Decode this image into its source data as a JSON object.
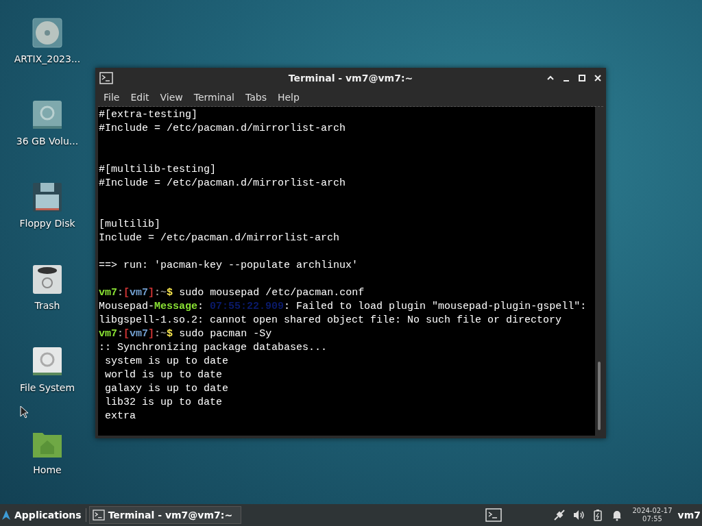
{
  "desktop_icons": [
    {
      "kind": "disc",
      "label": "ARTIX_2023..."
    },
    {
      "kind": "drive",
      "label": "36 GB Volu..."
    },
    {
      "kind": "floppy",
      "label": "Floppy Disk"
    },
    {
      "kind": "trash",
      "label": "Trash"
    },
    {
      "kind": "drive-light",
      "label": "File System"
    },
    {
      "kind": "folder",
      "label": "Home"
    }
  ],
  "window": {
    "title": "Terminal - vm7@vm7:~",
    "menu": [
      "File",
      "Edit",
      "View",
      "Terminal",
      "Tabs",
      "Help"
    ],
    "lines": [
      {
        "kind": "text",
        "text": "#[extra-testing]"
      },
      {
        "kind": "text",
        "text": "#Include = /etc/pacman.d/mirrorlist-arch"
      },
      {
        "kind": "blank"
      },
      {
        "kind": "blank"
      },
      {
        "kind": "text",
        "text": "#[multilib-testing]"
      },
      {
        "kind": "text",
        "text": "#Include = /etc/pacman.d/mirrorlist-arch"
      },
      {
        "kind": "blank"
      },
      {
        "kind": "blank"
      },
      {
        "kind": "text",
        "text": "[multilib]"
      },
      {
        "kind": "text",
        "text": "Include = /etc/pacman.d/mirrorlist-arch"
      },
      {
        "kind": "blank"
      },
      {
        "kind": "text",
        "text": "==> run: 'pacman-key --populate archlinux'"
      },
      {
        "kind": "blank"
      },
      {
        "kind": "segments",
        "segments": [
          {
            "text": "vm7",
            "color": "#8ae234"
          },
          {
            "text": ":",
            "color": "#aaaaaa"
          },
          {
            "text": "[",
            "color": "#cc3333"
          },
          {
            "text": "vm7",
            "color": "#729fcf"
          },
          {
            "text": "]",
            "color": "#cc3333"
          },
          {
            "text": ":",
            "color": "#aaaaaa"
          },
          {
            "text": "~",
            "color": "#888888"
          },
          {
            "text": "$",
            "color": "#fce94f"
          },
          {
            "text": " sudo mousepad /etc/pacman.conf",
            "color": "#ffffff"
          }
        ]
      },
      {
        "kind": "segments",
        "segments": [
          {
            "text": "Mousepad-",
            "color": "#ffffff"
          },
          {
            "text": "Message",
            "color": "#8ae234"
          },
          {
            "text": ": ",
            "color": "#ffffff"
          },
          {
            "text": "07:55:22.909",
            "color": "#0a1a6a"
          },
          {
            "text": ": Failed to load plugin \"mousepad-plugin-gspell\":",
            "color": "#ffffff"
          }
        ]
      },
      {
        "kind": "text",
        "text": "libgspell-1.so.2: cannot open shared object file: No such file or directory"
      },
      {
        "kind": "segments",
        "segments": [
          {
            "text": "vm7",
            "color": "#8ae234"
          },
          {
            "text": ":",
            "color": "#aaaaaa"
          },
          {
            "text": "[",
            "color": "#cc3333"
          },
          {
            "text": "vm7",
            "color": "#729fcf"
          },
          {
            "text": "]",
            "color": "#cc3333"
          },
          {
            "text": ":",
            "color": "#aaaaaa"
          },
          {
            "text": "~",
            "color": "#888888"
          },
          {
            "text": "$",
            "color": "#fce94f"
          },
          {
            "text": " sudo pacman -Sy",
            "color": "#ffffff"
          }
        ]
      },
      {
        "kind": "text",
        "text": ":: Synchronizing package databases..."
      },
      {
        "kind": "text",
        "text": " system is up to date"
      },
      {
        "kind": "text",
        "text": " world is up to date"
      },
      {
        "kind": "text",
        "text": " galaxy is up to date"
      },
      {
        "kind": "text",
        "text": " lib32 is up to date"
      },
      {
        "kind": "text",
        "text": " extra"
      }
    ]
  },
  "taskbar": {
    "applications": "Applications",
    "task": "Terminal - vm7@vm7:~",
    "date": "2024-02-17",
    "time": "07:55",
    "user": "vm7"
  }
}
